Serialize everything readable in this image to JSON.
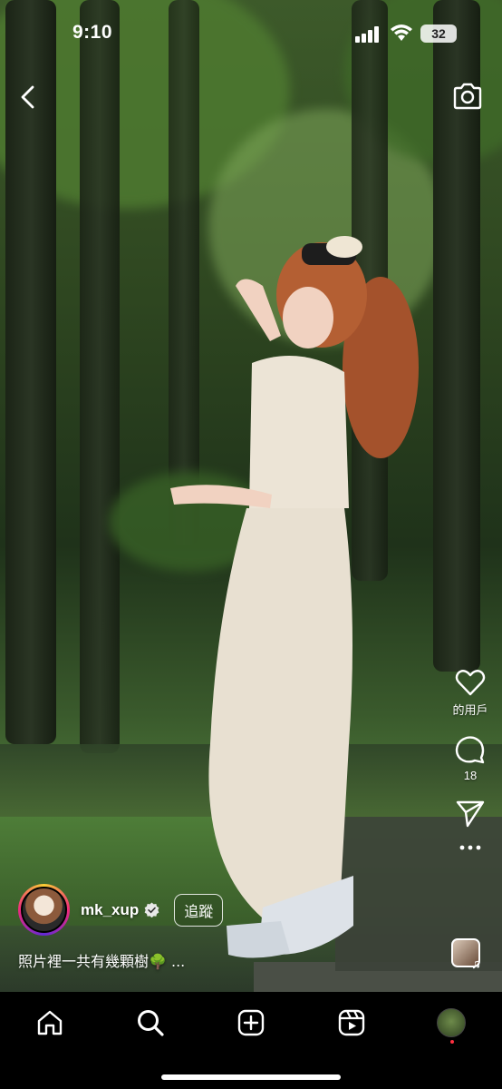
{
  "status_bar": {
    "time": "9:10",
    "battery": "32"
  },
  "post": {
    "username": "mk_xup",
    "follow_label": "追蹤",
    "caption": "照片裡一共有幾顆樹🌳 ...",
    "likes_label": "的用戶",
    "comments_count": "18"
  },
  "icons": {
    "back": "back-arrow-icon",
    "camera": "camera-icon",
    "like": "heart-icon",
    "comment": "comment-icon",
    "share": "send-icon",
    "more": "more-icon",
    "verified": "verified-badge-icon",
    "music": "music-note-icon"
  },
  "tabs": [
    "home",
    "search",
    "create",
    "reels",
    "profile"
  ],
  "colors": {
    "tab_bar": "#000000",
    "notification_dot": "#ff3040"
  }
}
